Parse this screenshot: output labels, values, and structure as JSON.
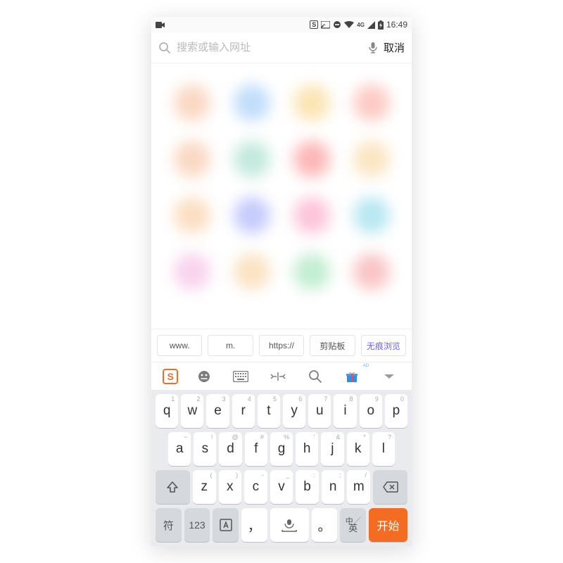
{
  "status": {
    "time": "16:49",
    "network": "4G"
  },
  "search": {
    "placeholder": "搜索或输入网址",
    "cancel": "取消"
  },
  "dials": [
    "#f3bfa0",
    "#9cc6f3",
    "#f5d38a",
    "#f5a9a0",
    "#f3bfa0",
    "#a0d9c7",
    "#f28a8a",
    "#f5d5a0",
    "#f5c9a0",
    "#a0a8f3",
    "#f5a0c0",
    "#8fd6e8",
    "#f0b7e0",
    "#f5d0a0",
    "#a0e0b7",
    "#f0a0a0"
  ],
  "chips": [
    "www.",
    "m.",
    "https://",
    "剪贴板",
    "无痕浏览"
  ],
  "ime_toolbar": {
    "ad_label": "AD"
  },
  "keyboard": {
    "row1": [
      {
        "k": "q",
        "s": "1"
      },
      {
        "k": "w",
        "s": "2"
      },
      {
        "k": "e",
        "s": "3"
      },
      {
        "k": "r",
        "s": "4"
      },
      {
        "k": "t",
        "s": "5"
      },
      {
        "k": "y",
        "s": "6"
      },
      {
        "k": "u",
        "s": "7"
      },
      {
        "k": "i",
        "s": "8"
      },
      {
        "k": "o",
        "s": "9"
      },
      {
        "k": "p",
        "s": "0"
      }
    ],
    "row2": [
      {
        "k": "a",
        "s": "~"
      },
      {
        "k": "s",
        "s": "!"
      },
      {
        "k": "d",
        "s": "@"
      },
      {
        "k": "f",
        "s": "#"
      },
      {
        "k": "g",
        "s": "%"
      },
      {
        "k": "h",
        "s": "'"
      },
      {
        "k": "j",
        "s": "&"
      },
      {
        "k": "k",
        "s": "*"
      },
      {
        "k": "l",
        "s": "?"
      }
    ],
    "row3": [
      {
        "k": "z",
        "s": "("
      },
      {
        "k": "x",
        "s": ")"
      },
      {
        "k": "c",
        "s": "-"
      },
      {
        "k": "v",
        "s": "_"
      },
      {
        "k": "b",
        "s": ":"
      },
      {
        "k": "n",
        "s": ";"
      },
      {
        "k": "m",
        "s": "/"
      }
    ],
    "bottom": {
      "sym": "符",
      "num": "123",
      "comma": "，",
      "period": "。",
      "lang_cn": "中",
      "lang_en": "英",
      "enter": "开始"
    }
  }
}
